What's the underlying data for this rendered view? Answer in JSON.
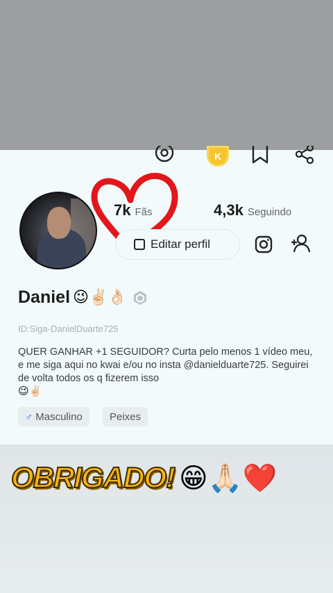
{
  "profile": {
    "stats": [
      {
        "value": "7k",
        "label": "Fãs"
      },
      {
        "value": "4,3k",
        "label": "Seguindo"
      }
    ],
    "edit_button_label": "Editar perfil",
    "name": "Daniel",
    "name_emojis": "😉✌🏻👌🏻",
    "user_id": "ID:Siga-DanielDuarte725",
    "bio": "QUER GANHAR +1 SEGUIDOR? Curta pelo menos 1 vídeo meu, e me siga aqui no kwai e/ou no insta @danielduarte725. Seguirei de volta todos os q fizerem isso",
    "bio_emojis": "😉✌🏻",
    "tags": [
      {
        "symbol": "♂",
        "label": "Masculino"
      },
      {
        "label": "Peixes"
      }
    ]
  },
  "overlay": {
    "thanks_text": "OBRIGADO!",
    "thanks_emojis": "😁🙏🏻❤️"
  },
  "colors": {
    "card_bg": "#f2fafb",
    "heart_red": "#e3161b",
    "coin": "#f6c42f",
    "thanks_yellow": "#f7b30f"
  },
  "icons": [
    "settings-icon",
    "coin-icon",
    "bookmark-icon",
    "share-icon",
    "pencil-icon",
    "instagram-icon",
    "add-user-icon",
    "verified-badge-icon"
  ]
}
